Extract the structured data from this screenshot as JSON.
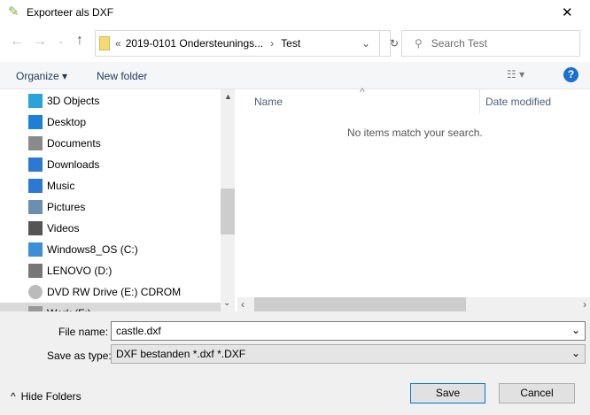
{
  "window": {
    "title": "Exporteer als DXF",
    "close": "✕"
  },
  "address": {
    "prefix": "«",
    "path": "2019-0101 Ondersteunings...",
    "sep": "›",
    "current": "Test"
  },
  "search": {
    "placeholder": "Search Test"
  },
  "toolbar": {
    "organize": "Organize ▾",
    "new_folder": "New folder"
  },
  "nav": {
    "items": [
      {
        "label": "3D Objects",
        "icon": "cube-icon",
        "color": "#29a3d9"
      },
      {
        "label": "Desktop",
        "icon": "desktop-icon",
        "color": "#1e7fd6"
      },
      {
        "label": "Documents",
        "icon": "documents-icon",
        "color": "#8a8a8a"
      },
      {
        "label": "Downloads",
        "icon": "downloads-icon",
        "color": "#2b79d0"
      },
      {
        "label": "Music",
        "icon": "music-icon",
        "color": "#2b79d0"
      },
      {
        "label": "Pictures",
        "icon": "pictures-icon",
        "color": "#6b8fb0"
      },
      {
        "label": "Videos",
        "icon": "videos-icon",
        "color": "#555"
      },
      {
        "label": "Windows8_OS (C:)",
        "icon": "drive-icon",
        "color": "#3c8fd6"
      },
      {
        "label": "LENOVO (D:)",
        "icon": "drive-icon",
        "color": "#777"
      },
      {
        "label": "DVD RW Drive (E:) CDROM",
        "icon": "dvd-icon",
        "color": "#bbb"
      },
      {
        "label": "Work (F:)",
        "icon": "drive-icon",
        "color": "#999"
      }
    ]
  },
  "content": {
    "col_name": "Name",
    "col_date": "Date modified",
    "empty": "No items match your search."
  },
  "form": {
    "filename_label": "File name:",
    "filename": "castle.dxf",
    "type_label": "Save as type:",
    "type": "DXF bestanden *.dxf *.DXF"
  },
  "footer": {
    "hide_folders": "Hide Folders",
    "save": "Save",
    "cancel": "Cancel"
  }
}
